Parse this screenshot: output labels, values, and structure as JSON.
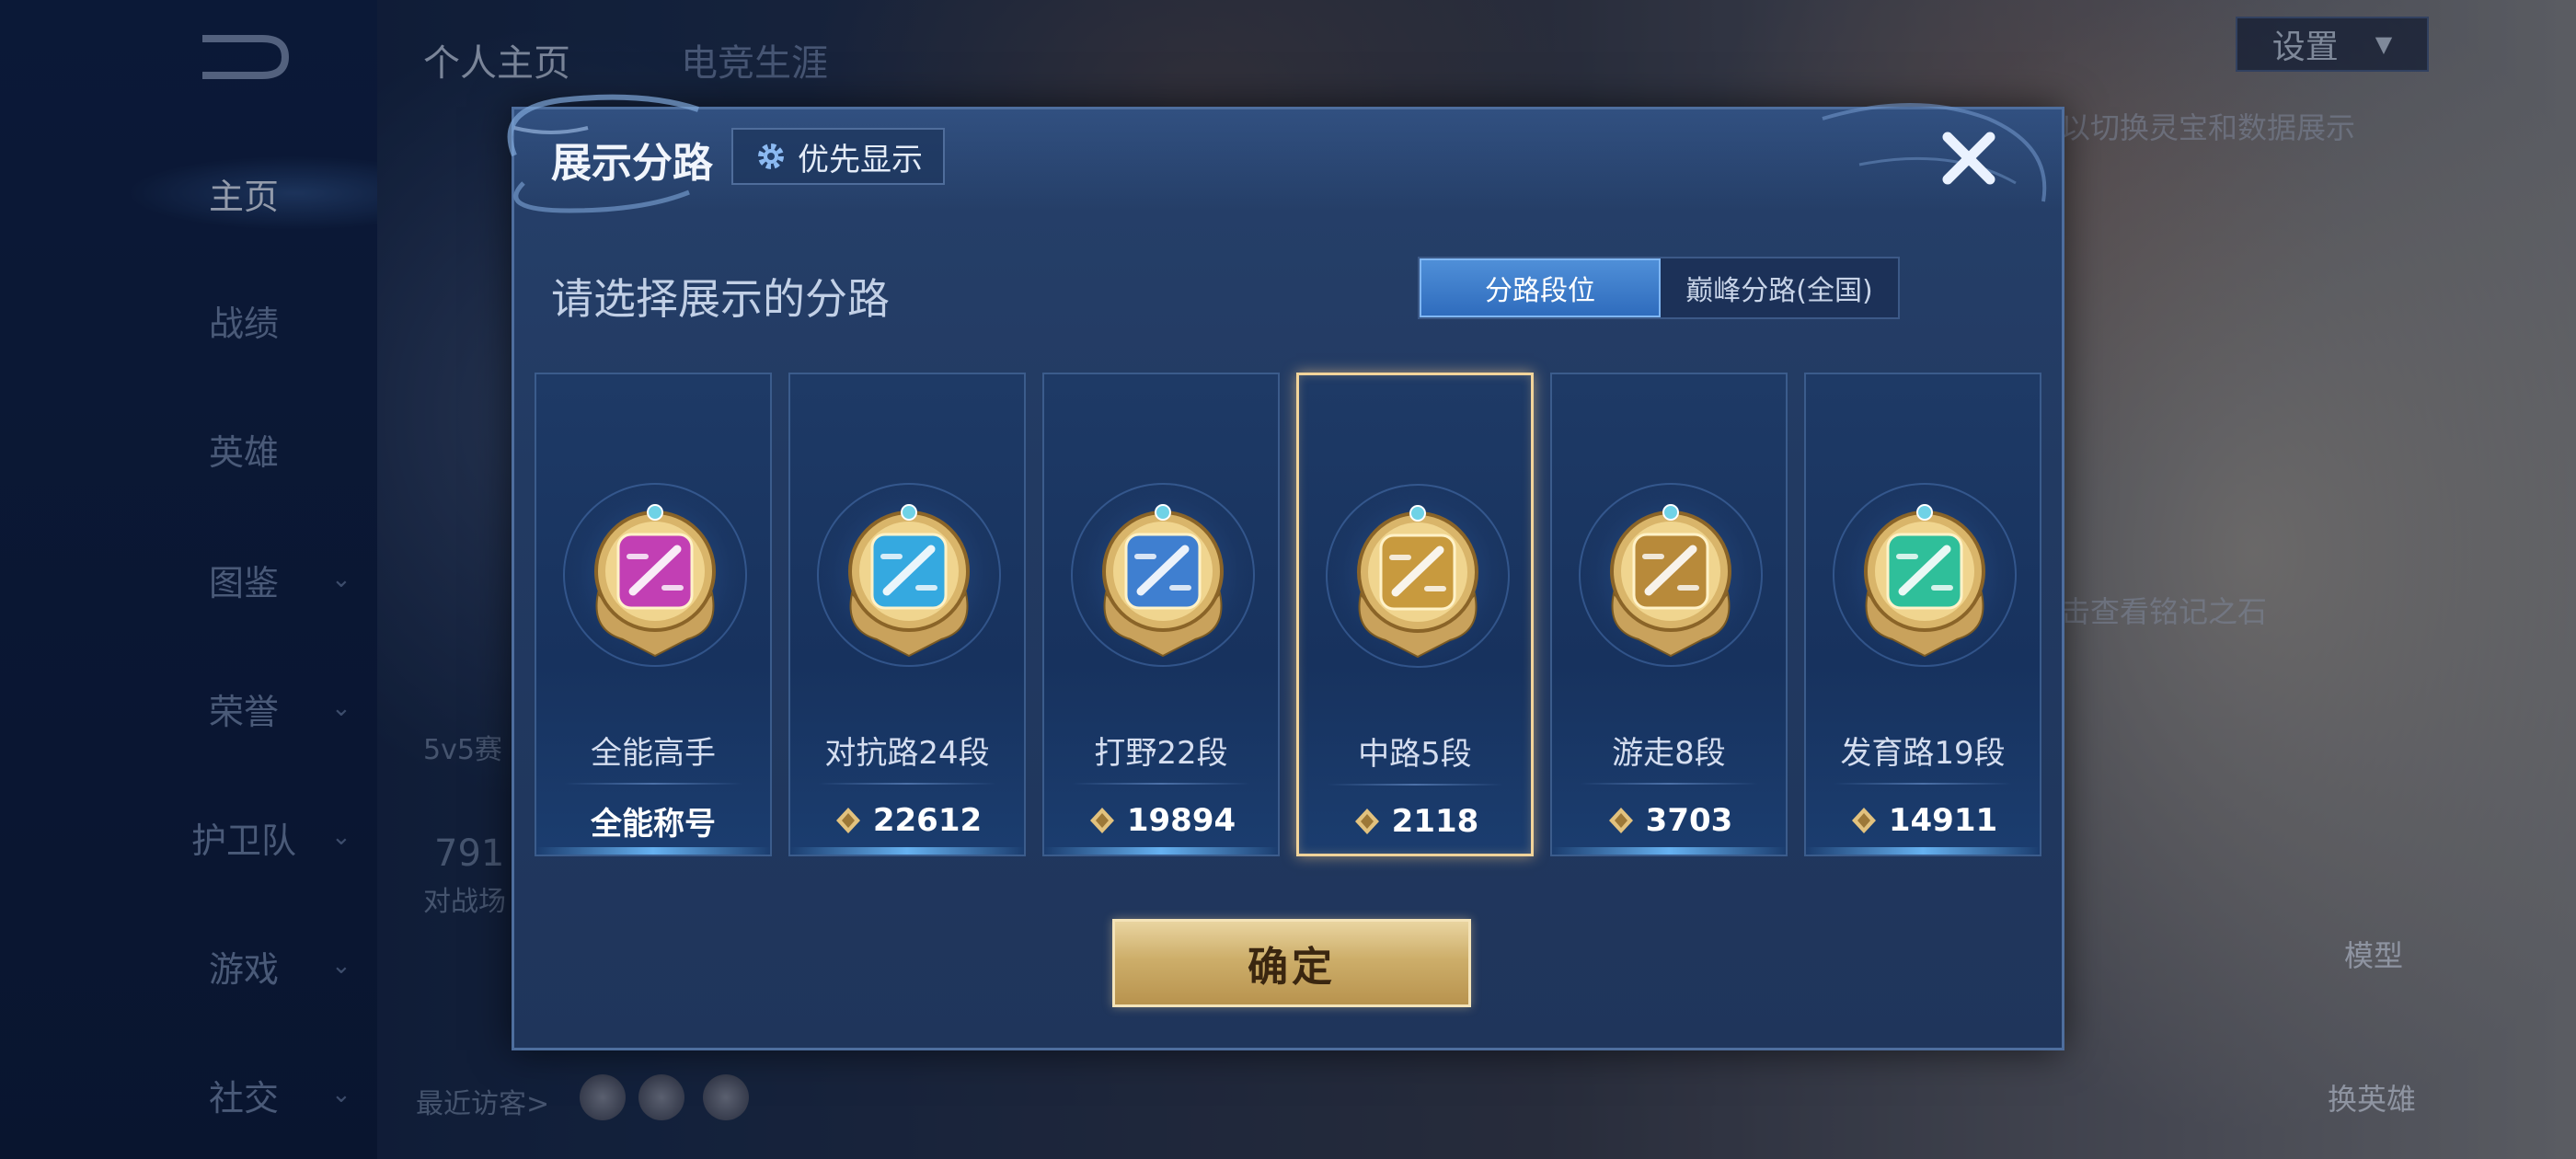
{
  "sidebar": {
    "items": [
      {
        "label": "主页",
        "active": true,
        "has_chevron": false
      },
      {
        "label": "战绩",
        "has_chevron": false
      },
      {
        "label": "英雄",
        "has_chevron": false
      },
      {
        "label": "图鉴",
        "has_chevron": true
      },
      {
        "label": "荣誉",
        "has_chevron": true
      },
      {
        "label": "护卫队",
        "has_chevron": true
      },
      {
        "label": "游戏",
        "has_chevron": true
      },
      {
        "label": "社交",
        "has_chevron": true
      }
    ]
  },
  "top_tabs": [
    {
      "label": "个人主页",
      "active": true
    },
    {
      "label": "电竞生涯",
      "active": false
    }
  ],
  "settings": {
    "label": "设置"
  },
  "background": {
    "hint_top": "以切换灵宝和数据展示",
    "hint_mid": "击查看铭记之石",
    "mode_label": "5v5赛",
    "count": "791",
    "count_caption": "对战场",
    "visitors_label": "最近访客>",
    "model_label": "模型",
    "swap_hero_label": "换英雄"
  },
  "dialog": {
    "title": "展示分路",
    "priority_label": "优先显示",
    "subtitle": "请选择展示的分路",
    "segment": [
      {
        "label": "分路段位",
        "active": true
      },
      {
        "label": "巅峰分路(全国)",
        "active": false
      }
    ],
    "confirm_label": "确定",
    "lanes": [
      {
        "name": "全能高手",
        "score": "全能称号",
        "has_score_icon": false,
        "selected": false,
        "gem_color": "#c23fb4"
      },
      {
        "name": "对抗路24段",
        "score": "22612",
        "has_score_icon": true,
        "selected": false,
        "gem_color": "#35a9e0"
      },
      {
        "name": "打野22段",
        "score": "19894",
        "has_score_icon": true,
        "selected": false,
        "gem_color": "#3f7fd0"
      },
      {
        "name": "中路5段",
        "score": "2118",
        "has_score_icon": true,
        "selected": true,
        "gem_color": "#c89a3e"
      },
      {
        "name": "游走8段",
        "score": "3703",
        "has_score_icon": true,
        "selected": false,
        "gem_color": "#b88a3a"
      },
      {
        "name": "发育路19段",
        "score": "14911",
        "has_score_icon": true,
        "selected": false,
        "gem_color": "#2fbf9a"
      }
    ]
  },
  "colors": {
    "accent_blue": "#3d7fce",
    "gold": "#d6b77a",
    "selected_border": "#f2d49a"
  }
}
